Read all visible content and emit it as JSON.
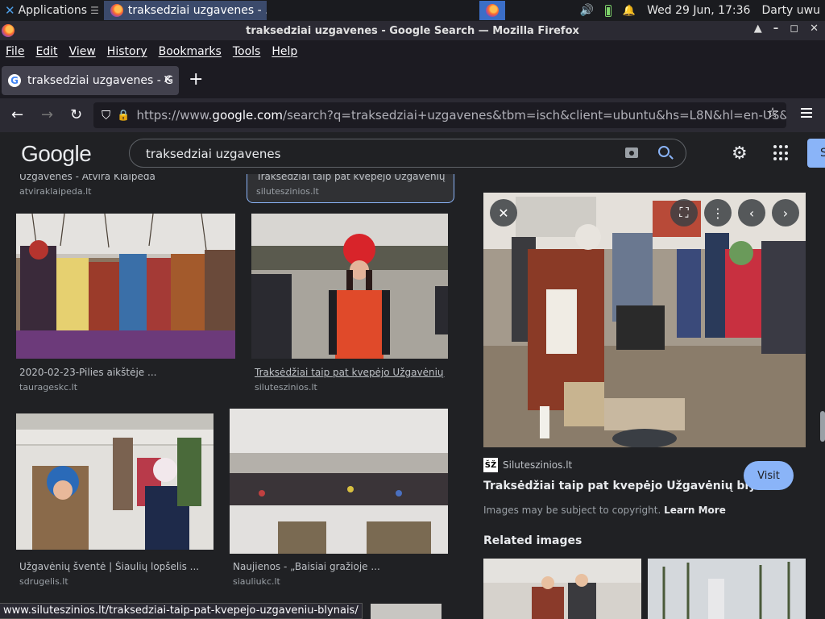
{
  "system_panel": {
    "applications_label": "Applications",
    "task_title": "traksedziai uzgavenes - ...",
    "clock": "Wed 29 Jun, 17:36",
    "user": "Darty uwu"
  },
  "window": {
    "title": "traksedziai uzgavenes - Google Search — Mozilla Firefox"
  },
  "menubar": {
    "items": [
      "File",
      "Edit",
      "View",
      "History",
      "Bookmarks",
      "Tools",
      "Help"
    ]
  },
  "tab": {
    "label": "traksedziai uzgavenes - G",
    "favicon_letter": "G"
  },
  "navbar": {
    "url_prefix": "https://www.",
    "url_domain": "google.com",
    "url_rest": "/search?q=traksedziai+uzgavenes&tbm=isch&client=ubuntu&hs=L8N&hl=en-US&s"
  },
  "google": {
    "logo_text": "Google",
    "query": "traksedziai uzgavenes",
    "signin_label": "S"
  },
  "results": {
    "top_left_caption": "Užgavėnes - Atvira Klaipėda",
    "top_left_site": "atviraklaipeda.lt",
    "top_right_caption": "Traksėdžiai taip pat kvepėjo Užgavėnių ...",
    "top_right_site": "siluteszinios.lt",
    "items": [
      {
        "caption": "2020-02-23-Pilies aikštėje ...",
        "site": "taurageskc.lt"
      },
      {
        "caption": "Traksėdžiai taip pat kvepėjo Užgavėnių ...",
        "site": "siluteszinios.lt"
      },
      {
        "caption": "Užgavėnių šventė | Šiaulių lopšelis ...",
        "site": "sdrugelis.lt"
      },
      {
        "caption": "Naujienos - „Baisiai gražioje ...",
        "site": "siauliukc.lt"
      }
    ]
  },
  "preview": {
    "site_favicon_text": "ŠŽ",
    "site_name": "Siluteszinios.lt",
    "title": "Traksėdžiai taip pat kvepėjo Užgavėnių blyn...",
    "visit_label": "Visit",
    "copyright_text": "Images may be subject to copyright.",
    "learn_more": "Learn More",
    "related_heading": "Related images"
  },
  "status_url": "www.siluteszinios.lt/traksedziai-taip-pat-kvepejo-uzgaveniu-blynais/",
  "colors": {
    "accent_blue": "#8ab4f8",
    "page_bg": "#202124",
    "firefox_chrome": "#2b2a33"
  }
}
